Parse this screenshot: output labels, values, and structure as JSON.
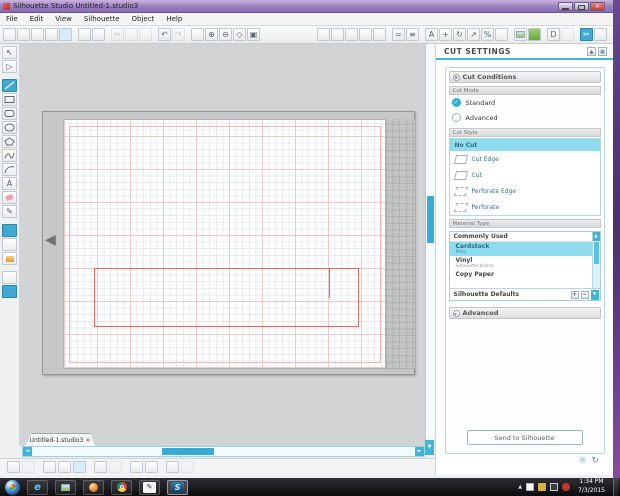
{
  "window": {
    "title": "Silhouette Studio Untitled-1.studio3"
  },
  "menu": {
    "items": [
      "File",
      "Edit",
      "View",
      "Silhouette",
      "Object",
      "Help"
    ]
  },
  "icons": {
    "close_x": "✕",
    "scissors": "✂",
    "undo": "↶",
    "redo": "↷",
    "zoom_in": "⊕",
    "zoom_out": "⊖",
    "diamond": "◇",
    "fit_page": "▣",
    "select": "↖",
    "edit_points": "▷",
    "text": "A",
    "pencil": "✎",
    "equals": "=",
    "lines": "≡",
    "move": "+",
    "rotate": "↻",
    "scale": "↗",
    "percent": "%",
    "library_d": "D",
    "panel_collapse": "▲",
    "panel_pin": "▦",
    "expand": "▼",
    "collapsed_arrow": "►",
    "check": "✓",
    "plus": "+",
    "minus": "−",
    "up": "▲",
    "down": "▼",
    "left": "◄",
    "right": "►",
    "mat_arrow": "◀",
    "gear": "☼",
    "sync": "↻",
    "tray_up": "▲",
    "ie": "e",
    "pen": "✎",
    "s_logo": "S"
  },
  "document_tab": {
    "label": "Untitled-1.studio3"
  },
  "panel": {
    "title": "CUT SETTINGS",
    "cut_conditions_label": "Cut Conditions",
    "cut_mode_label": "Cut Mode",
    "modes": [
      {
        "label": "Standard",
        "selected": true
      },
      {
        "label": "Advanced",
        "selected": false
      }
    ],
    "cut_style_label": "Cut Style",
    "styles": [
      {
        "label": "No Cut",
        "selected": true
      },
      {
        "label": "Cut Edge",
        "selected": false
      },
      {
        "label": "Cut",
        "selected": false
      },
      {
        "label": "Perforate Edge",
        "selected": false
      },
      {
        "label": "Perforate",
        "selected": false
      }
    ],
    "material_type_label": "Material Type",
    "materials": {
      "group_header": "Commonly Used",
      "items": [
        {
          "name": "Cardstock",
          "sub": "Plain",
          "selected": true
        },
        {
          "name": "Vinyl",
          "sub": "Silhouette brand",
          "selected": false
        },
        {
          "name": "Copy Paper",
          "sub": "",
          "selected": false
        }
      ],
      "footer": "Silhouette Defaults"
    },
    "advanced_label": "Advanced",
    "send_button_label": "Send to Silhouette"
  },
  "taskbar": {
    "clock_time": "1:34 PM",
    "clock_date": "7/3/2015"
  }
}
